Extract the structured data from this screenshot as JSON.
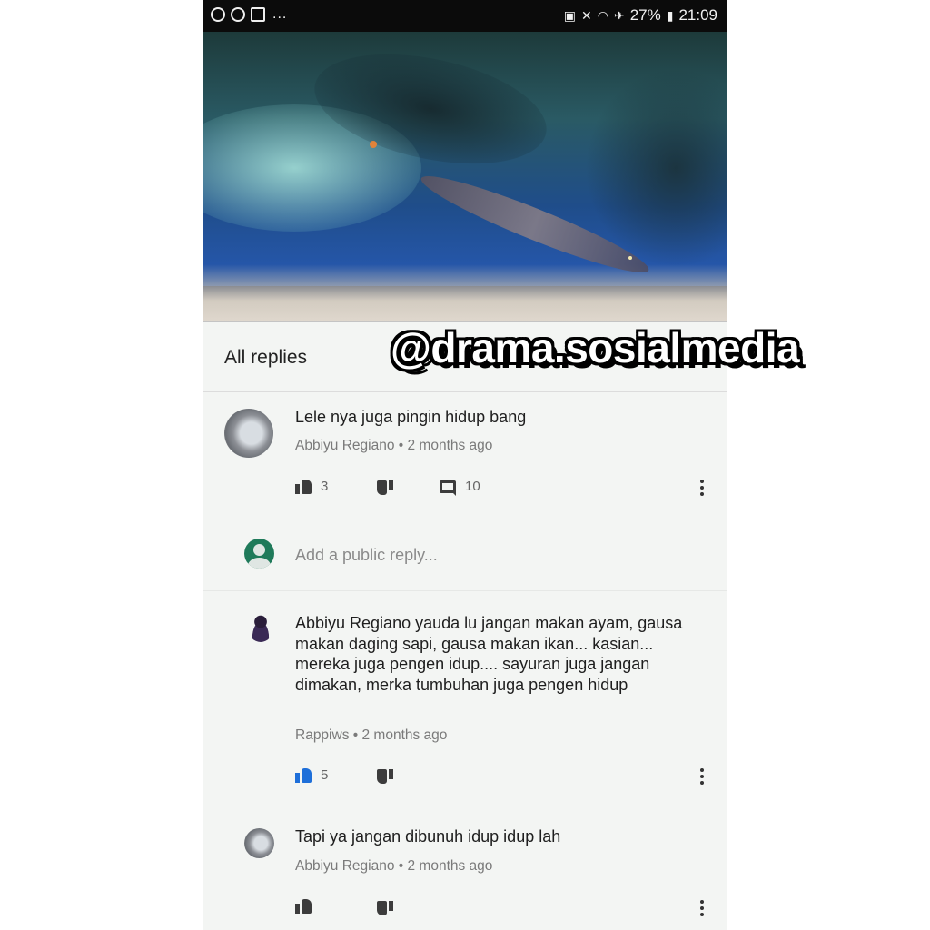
{
  "status_bar": {
    "battery": "27%",
    "time": "21:09",
    "left_icons": [
      "whatsapp-icon",
      "chat-icon",
      "gallery-icon"
    ],
    "overflow": "..."
  },
  "video": {
    "progress": 0.0
  },
  "header": {
    "title": "All replies"
  },
  "watermark": "@drama.sosialmedia",
  "comments": [
    {
      "text": "Lele nya juga pingin hidup bang",
      "author": "Abbiyu Regiano",
      "time": "2 months ago",
      "likes": "3",
      "replies": "10"
    },
    {
      "text": "Abbiyu Regiano yauda lu jangan makan ayam, gausa makan daging sapi, gausa makan ikan... kasian... mereka juga pengen idup.... sayuran juga jangan dimakan, merka tumbuhan juga pengen hidup",
      "author": "Rappiws",
      "time": "2 months ago",
      "likes": "5"
    },
    {
      "text": "Tapi ya jangan dibunuh idup idup lah",
      "author": "Abbiyu Regiano",
      "time": "2 months ago",
      "likes": ""
    }
  ],
  "reply_input": {
    "placeholder": "Add a public reply..."
  },
  "colors": {
    "like_active": "#1e6fd9",
    "progress": "#d11a1a",
    "avatar_green": "#1f7a5a"
  }
}
